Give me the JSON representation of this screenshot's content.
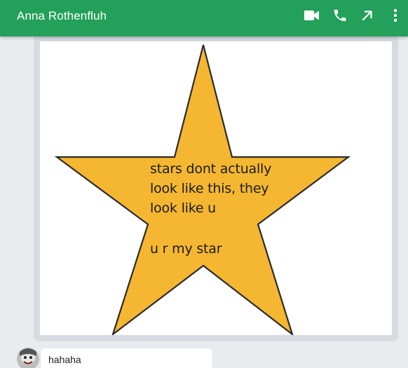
{
  "header": {
    "title": "Anna Rothenfluh",
    "background": "#23a05a",
    "icons": {
      "video": "video-call-icon",
      "phone": "phone-call-icon",
      "open": "open-external-icon",
      "menu": "more-vert-icon"
    }
  },
  "message_image": {
    "star_color": "#f5b731",
    "lines": [
      "stars dont actually",
      "look like this, they",
      "look like u",
      "u r my star"
    ]
  },
  "reply": {
    "avatar_icon": "contact-avatar",
    "text": "hahaha"
  }
}
